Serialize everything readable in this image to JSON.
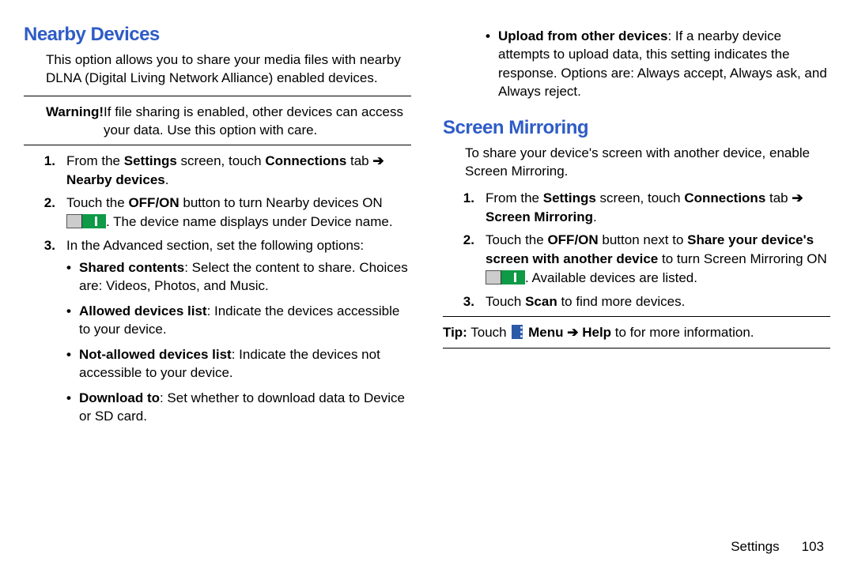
{
  "left": {
    "heading": "Nearby Devices",
    "intro": "This option allows you to share your media files with nearby DLNA (Digital Living Network Alliance) enabled devices.",
    "warning_label": "Warning!",
    "warning_text": "If file sharing is enabled, other devices can access your data. Use this option with care.",
    "steps": {
      "s1_a": "From the ",
      "s1_b": "Settings",
      "s1_c": " screen, touch ",
      "s1_d": "Connections",
      "s1_e": " tab ",
      "s1_f": "Nearby devices",
      "s1_g": ".",
      "s2_a": "Touch the ",
      "s2_b": "OFF/ON",
      "s2_c": " button to turn Nearby devices ON ",
      "s2_d": ". The device name displays under Device name.",
      "s3": "In the Advanced section, set the following options:",
      "b1_a": "Shared contents",
      "b1_b": ": Select the content to share. Choices are: Videos, Photos, and Music.",
      "b2_a": "Allowed devices list",
      "b2_b": ": Indicate the devices accessible to your device.",
      "b3_a": "Not-allowed devices list",
      "b3_b": ": Indicate the devices not accessible to your device.",
      "b4_a": "Download to",
      "b4_b": ": Set whether to download data to Device or SD card."
    }
  },
  "right": {
    "upload_a": "Upload from other devices",
    "upload_b": ": If a nearby device attempts to upload data, this setting indicates the response. Options are: Always accept, Always ask, and Always reject.",
    "heading": "Screen Mirroring",
    "intro": "To share your device's screen with another device, enable Screen Mirroring.",
    "steps": {
      "s1_a": "From the ",
      "s1_b": "Settings",
      "s1_c": " screen, touch ",
      "s1_d": "Connections",
      "s1_e": " tab ",
      "s1_f": "Screen Mirroring",
      "s1_g": ".",
      "s2_a": "Touch the ",
      "s2_b": "OFF/ON",
      "s2_c": " button next to ",
      "s2_d": "Share your device's screen with another device",
      "s2_e": " to turn Screen Mirroring ON ",
      "s2_f": ". Available devices are listed.",
      "s3_a": "Touch ",
      "s3_b": "Scan",
      "s3_c": " to find more devices."
    },
    "tip_label": "Tip:",
    "tip_a": " Touch ",
    "tip_b": "Menu",
    "tip_c": "Help",
    "tip_d": " to for more information."
  },
  "arrow": "➔",
  "footer": {
    "section": "Settings",
    "page": "103"
  }
}
